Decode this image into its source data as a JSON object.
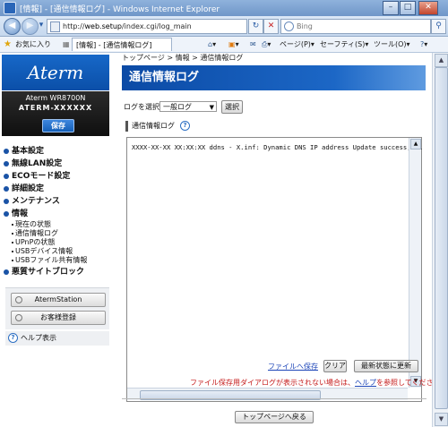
{
  "window": {
    "title": "[情報] - [通信情報ログ] - Windows Internet Explorer",
    "minimize": "–",
    "maximize": "□",
    "close": "✕"
  },
  "addressbar": {
    "url_prefix": "http://",
    "url_host": "web.setup",
    "url_path": "/index.cgi/log_main",
    "search_placeholder": "Bing"
  },
  "favorites": {
    "label": "お気に入り",
    "tab_title": "[情報] - [通信情報ログ]",
    "page_menu": "ページ(P)",
    "safety_menu": "セーフティ(S)",
    "tools_menu": "ツール(O)"
  },
  "sidebar": {
    "logo": "Aterm",
    "model_line1": "Aterm WR8700N",
    "model_line2": "ATERM-XXXXXX",
    "save_button": "保存",
    "menu": [
      {
        "label": "基本設定"
      },
      {
        "label": "無線LAN設定"
      },
      {
        "label": "ECOモード設定"
      },
      {
        "label": "詳細設定"
      },
      {
        "label": "メンテナンス"
      },
      {
        "label": "情報"
      }
    ],
    "info_sub": [
      {
        "label": "現在の状態"
      },
      {
        "label": "通信情報ログ"
      },
      {
        "label": "UPnPの状態"
      },
      {
        "label": "USBデバイス情報"
      },
      {
        "label": "USBファイル共有情報"
      }
    ],
    "menu_last": "悪質サイトブロック",
    "btn_station": "AtermStation",
    "btn_register": "お客様登録",
    "help": "ヘルプ表示"
  },
  "main": {
    "breadcrumb": "トップページ > 情報 > 通信情報ログ",
    "title": "通信情報ログ",
    "select_label": "ログを選択",
    "select_value": "一般ログ",
    "select_button": "選択",
    "section_title": "通信情報ログ",
    "log_line": "XXXX-XX-XX XX:XX:XX ddns - X.inf: Dynamic DNS IP address Update success, sit",
    "save_link": "ファイルへ保存",
    "clear_button": "クリア",
    "refresh_button": "最新状態に更新",
    "warning_text": "ファイル保存用ダイアログが表示されない場合は、",
    "warning_link": "ヘルプ",
    "warning_tail": "を参照してください。",
    "top_button": "トップページへ戻る"
  }
}
